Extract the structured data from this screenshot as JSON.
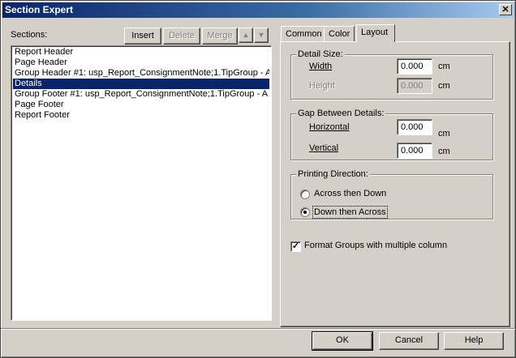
{
  "window": {
    "title": "Section Expert",
    "close_glyph": "✕"
  },
  "sections": {
    "label": "Sections:",
    "toolbar": {
      "insert_label": "Insert",
      "delete_label": "Delete",
      "merge_label": "Merge",
      "up_glyph": "▲",
      "down_glyph": "▼"
    },
    "items": [
      {
        "label": "Report Header"
      },
      {
        "label": "Page Header"
      },
      {
        "label": "Group Header #1: usp_Report_ConsignmentNote;1.TipGroup - A"
      },
      {
        "label": "Details"
      },
      {
        "label": "Group Footer #1: usp_Report_ConsignmentNote;1.TipGroup - A"
      },
      {
        "label": "Page Footer"
      },
      {
        "label": "Report Footer"
      }
    ],
    "selected_index": 3
  },
  "tabs": [
    {
      "label": "Common"
    },
    {
      "label": "Color"
    },
    {
      "label": "Layout"
    }
  ],
  "active_tab": "Layout",
  "layout": {
    "detail_size": {
      "legend": "Detail Size:",
      "width_label": "Width",
      "width_value": "0.000",
      "width_unit": "cm",
      "height_label": "Height",
      "height_value": "0.000",
      "height_unit": "cm"
    },
    "gap": {
      "legend": "Gap Between Details:",
      "horizontal_label": "Horizontal",
      "horizontal_value": "0.000",
      "horizontal_unit": "cm",
      "vertical_label": "Vertical",
      "vertical_value": "0.000",
      "vertical_unit": "cm"
    },
    "printing_direction": {
      "legend": "Printing Direction:",
      "option1": "Across then Down",
      "option2": "Down then Across",
      "selected": "Down then Across"
    },
    "format_groups": {
      "label": "Format Groups with multiple column",
      "checked": true,
      "check_glyph": "✓"
    }
  },
  "buttons": {
    "ok": "OK",
    "cancel": "Cancel",
    "help": "Help"
  }
}
